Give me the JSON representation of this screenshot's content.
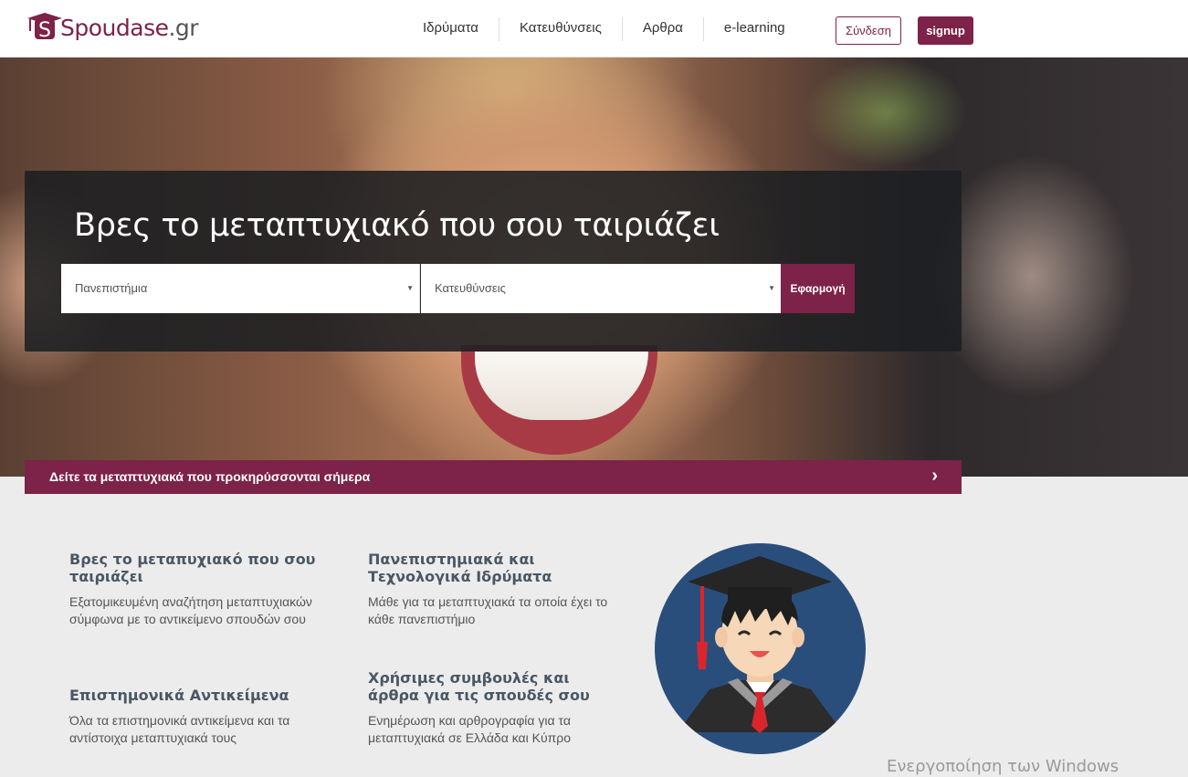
{
  "brand": {
    "logo_main": "Spoudase",
    "logo_tld": ".gr"
  },
  "nav": {
    "items": [
      {
        "label": "Ιδρύματα"
      },
      {
        "label": "Κατευθύνσεις"
      },
      {
        "label": "Αρθρα"
      },
      {
        "label": "e-learning"
      }
    ],
    "login_label": "Σύνδεση",
    "signup_label": "signup"
  },
  "hero": {
    "title": "Βρες το μεταπτυχιακό που σου ταιριάζει",
    "university_select": {
      "selected": "Πανεπιστήμια"
    },
    "direction_select": {
      "selected": "Κατευθύνσεις"
    },
    "apply_label": "Εφαρμογή"
  },
  "banner": {
    "text": "Δείτε τα μεταπτυχιακά που προκηρύσσονται σήμερα",
    "arrow": "›"
  },
  "features": [
    {
      "title": "Βρες το μεταπυχιακό που σου ταιριάζει",
      "text": "Εξατομικευμένη αναζήτηση μεταπτυχιακών σύμφωνα με το αντικείμενο σπουδών σου"
    },
    {
      "title": "Πανεπιστημιακά και Τεχνολογικά Ιδρύματα",
      "text": "Μάθε για τα μεταπτυχιακά τα οποία έχει το κάθε πανεπιστήμιο"
    },
    {
      "title": "Επιστημονικά Αντικείμενα",
      "text": "Όλα τα επιστημονικά αντικείμενα και τα αντίστοιχα μεταπτυχιακά τους"
    },
    {
      "title": "Χρήσιμες συμβουλές και άρθρα για τις σπουδές σου",
      "text": "Ενημέρωση και αρθρογραφία για τα μεταπτυχιακά σε Ελλάδα και Κύπρο"
    }
  ],
  "os_watermark": "Ενεργοποίηση των Windows",
  "colors": {
    "brand": "#7d2248",
    "graduate_circle": "#2a4e7c",
    "panel": "#1c1f22"
  },
  "icons": [
    "graduate-illustration",
    "chevron-right-icon",
    "caret-down-icon"
  ]
}
